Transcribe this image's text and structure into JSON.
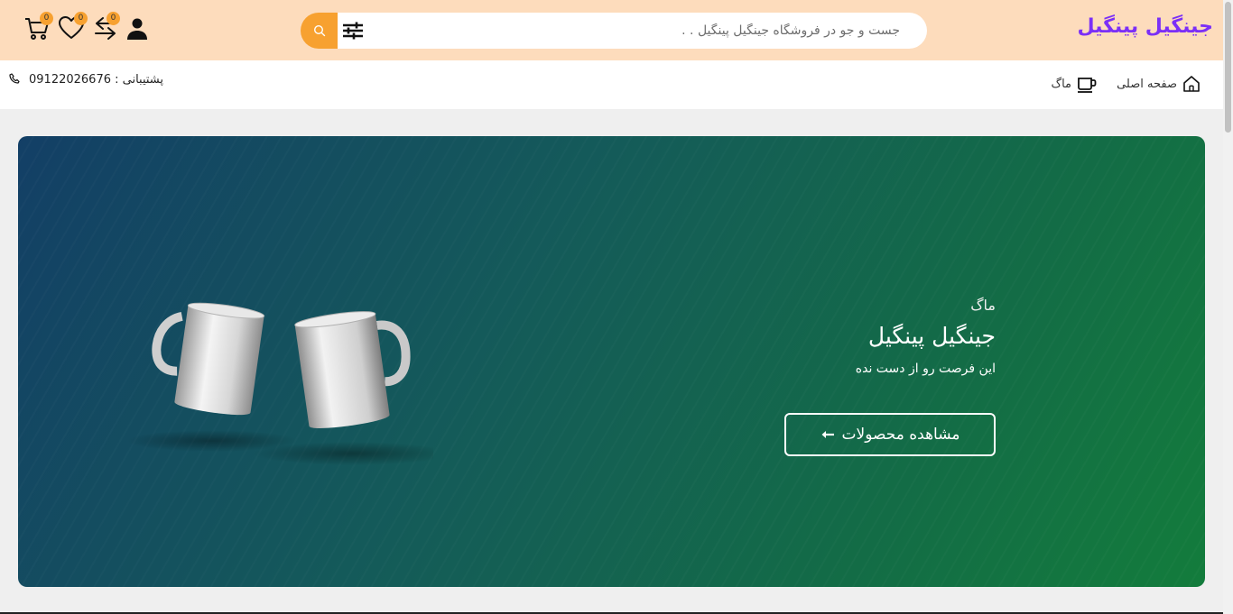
{
  "header": {
    "logo": "جینگیل پینگیل",
    "search": {
      "placeholder": "جست و جو در فروشگاه جینگیل پینگیل . ."
    },
    "counts": {
      "compare": "0",
      "wishlist": "0",
      "cart": "0"
    }
  },
  "nav": {
    "items": [
      {
        "label": "صفحه اصلی",
        "icon": "home-icon"
      },
      {
        "label": "ماگ",
        "icon": "mug-icon"
      }
    ],
    "support": "پشتیبانی : 09122026676"
  },
  "hero": {
    "kicker": "ماگ",
    "title": "جینگیل پینگیل",
    "subtitle": "این فرصت رو از دست نده",
    "button_label": "مشاهده محصولات"
  },
  "colors": {
    "header_bg": "#fddcbc",
    "logo": "#7b2ff7",
    "accent": "#f7a130",
    "hero_start": "#133f66",
    "hero_end": "#137c3c"
  }
}
